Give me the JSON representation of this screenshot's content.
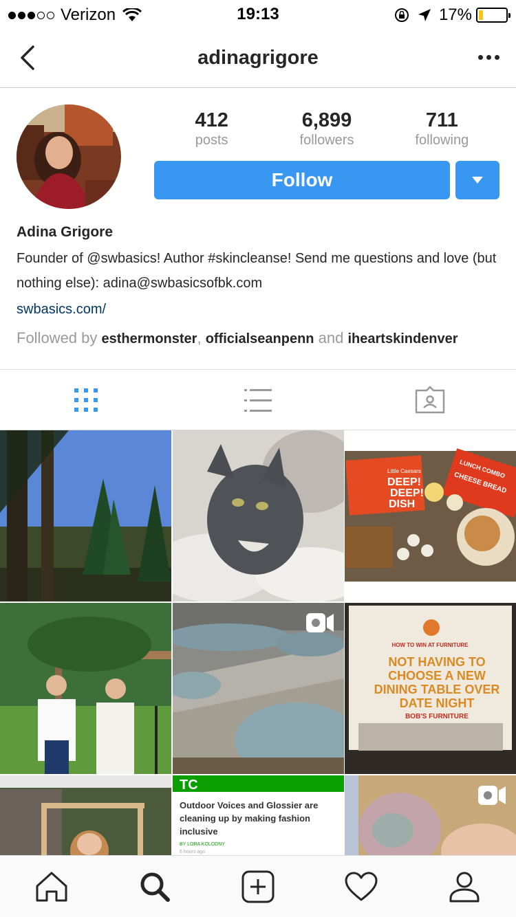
{
  "status_bar": {
    "carrier": "Verizon",
    "time": "19:13",
    "battery_percent": "17%",
    "battery_level": 0.17,
    "signal_bars_filled": 3,
    "signal_bars_total": 5
  },
  "nav": {
    "title": "adinagrigore"
  },
  "profile": {
    "stats": [
      {
        "value": "412",
        "label": "posts"
      },
      {
        "value": "6,899",
        "label": "followers"
      },
      {
        "value": "711",
        "label": "following"
      }
    ],
    "follow_label": "Follow",
    "name": "Adina Grigore",
    "bio": "Founder of @swbasics! Author #skincleanse! Send me questions and love (but nothing else): adina@swbasicsofbk.com",
    "website": "swbasics.com/",
    "followed_by": {
      "prefix": "Followed by",
      "user1": "esthermonster",
      "sep1": ",",
      "user2": "officialseanpenn",
      "and": "and",
      "user3": "iheartskindenver"
    }
  },
  "grid": {
    "tile_6": {
      "brand": "HOW TO WIN AT FURNITURE",
      "line1": "NOT HAVING TO",
      "line2": "CHOOSE A NEW",
      "line3": "DINING TABLE OVER",
      "line4": "DATE NIGHT",
      "store": "BOB'S FURNITURE"
    },
    "tile_3": {
      "box1_top": "Little Caesars",
      "box1_line1": "DEEP!",
      "box1_line2": "DEEP!",
      "box1_line3": "DISH",
      "box2_line1": "LUNCH COMBO",
      "box2_line2": "CHEESE BREAD"
    },
    "tile_8": {
      "logo": "TC",
      "headline_line1": "Outdoor Voices and Glossier are",
      "headline_line2": "cleaning up by making fashion",
      "headline_line3": "inclusive",
      "byline": "BY LORA KOLODNY",
      "time": "6 hours ago"
    }
  },
  "icons": {
    "accent": "#3897f0",
    "link_color": "#003569"
  }
}
